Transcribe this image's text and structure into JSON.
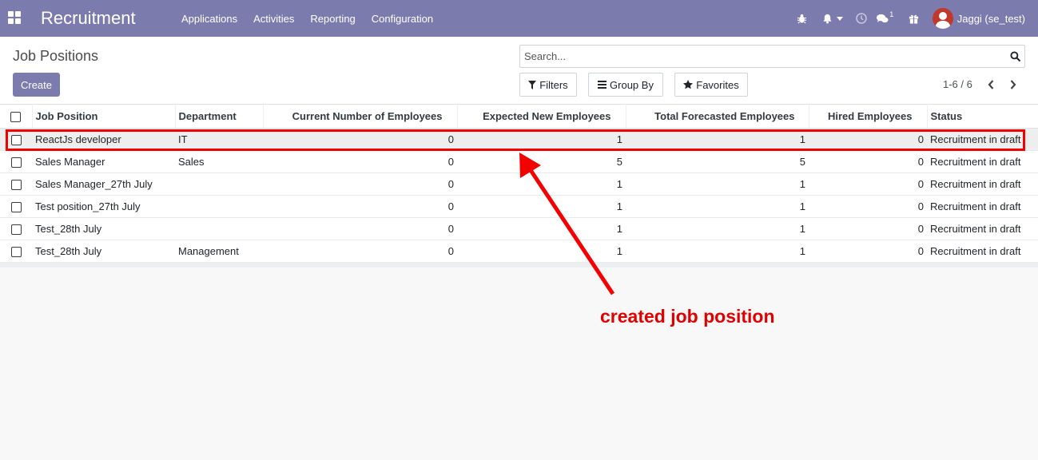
{
  "navbar": {
    "brand": "Recruitment",
    "menu": [
      "Applications",
      "Activities",
      "Reporting",
      "Configuration"
    ],
    "chat_count": "1",
    "user_name": "Jaggi (se_test)"
  },
  "control_panel": {
    "title": "Job Positions",
    "create_label": "Create",
    "search_placeholder": "Search...",
    "filters_label": "Filters",
    "group_by_label": "Group By",
    "favorites_label": "Favorites",
    "pager_text": "1-6 / 6"
  },
  "table": {
    "headers": {
      "job_position": "Job Position",
      "department": "Department",
      "current": "Current Number of Employees",
      "expected": "Expected New Employees",
      "forecast": "Total Forecasted Employees",
      "hired": "Hired Employees",
      "status": "Status"
    },
    "rows": [
      {
        "name": "ReactJs developer",
        "department": "IT",
        "current": "0",
        "expected": "1",
        "forecast": "1",
        "hired": "0",
        "status": "Recruitment in draft"
      },
      {
        "name": "Sales Manager",
        "department": "Sales",
        "current": "0",
        "expected": "5",
        "forecast": "5",
        "hired": "0",
        "status": "Recruitment in draft"
      },
      {
        "name": "Sales Manager_27th July",
        "department": "",
        "current": "0",
        "expected": "1",
        "forecast": "1",
        "hired": "0",
        "status": "Recruitment in draft"
      },
      {
        "name": "Test position_27th July",
        "department": "",
        "current": "0",
        "expected": "1",
        "forecast": "1",
        "hired": "0",
        "status": "Recruitment in draft"
      },
      {
        "name": "Test_28th July",
        "department": "",
        "current": "0",
        "expected": "1",
        "forecast": "1",
        "hired": "0",
        "status": "Recruitment in draft"
      },
      {
        "name": "Test_28th July",
        "department": "Management",
        "current": "0",
        "expected": "1",
        "forecast": "1",
        "hired": "0",
        "status": "Recruitment in draft"
      }
    ]
  },
  "annotation": {
    "text": "created job position",
    "color": "#e00000"
  },
  "colors": {
    "brand": "#7c7bad",
    "highlight": "#f50000"
  }
}
